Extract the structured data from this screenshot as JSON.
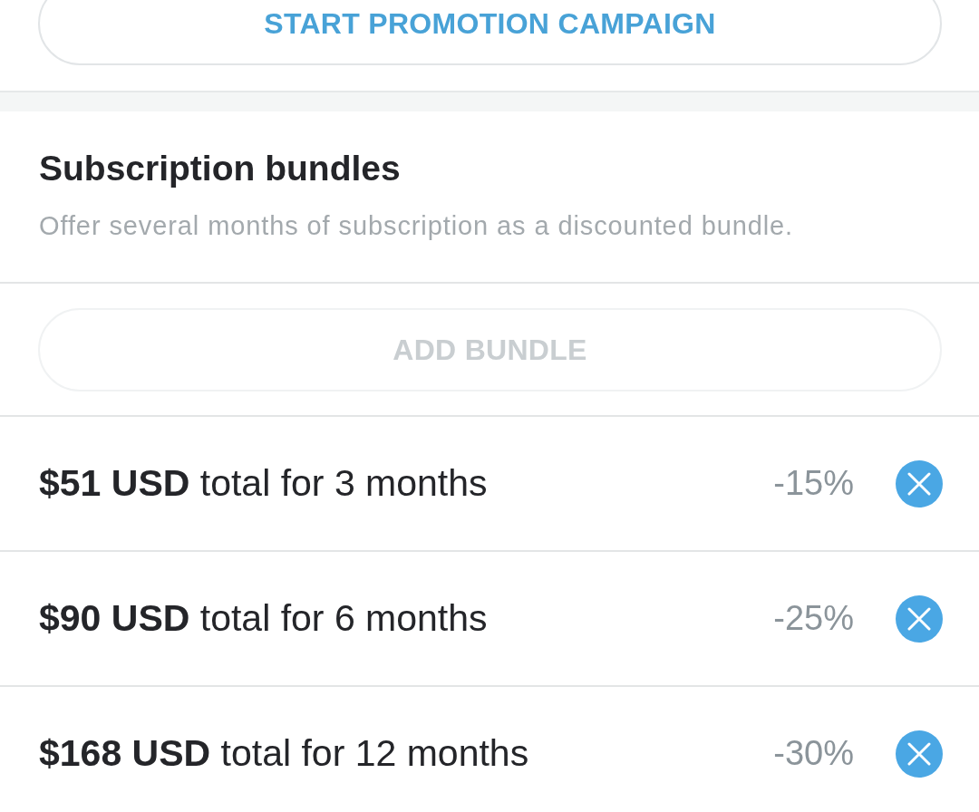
{
  "promotion_button": {
    "label": "START PROMOTION CAMPAIGN",
    "disabled": false
  },
  "subscription_bundles": {
    "title": "Subscription bundles",
    "description": "Offer several months of subscription as a discounted bundle.",
    "add_button": {
      "label": "ADD BUNDLE",
      "disabled": true
    },
    "bundles": [
      {
        "summary": "**$51 USD** total for 3 months",
        "discount": "-15%"
      },
      {
        "summary": "**$90 USD** total for 6 months",
        "discount": "-25%"
      },
      {
        "summary": "**$168 USD** total for 12 months",
        "discount": "-30%"
      }
    ]
  }
}
